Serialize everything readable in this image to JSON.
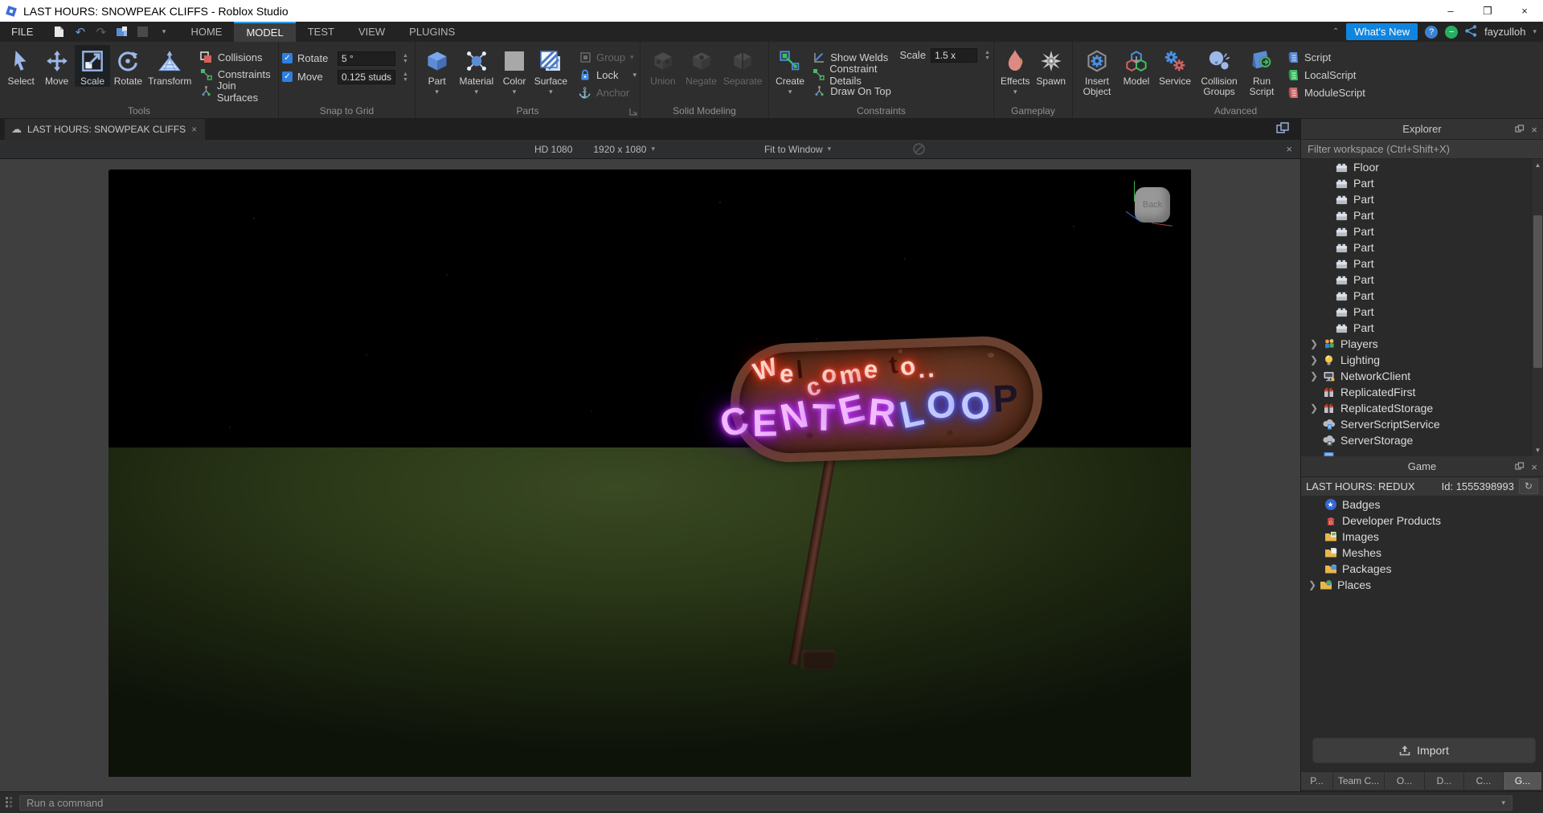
{
  "window": {
    "title": "LAST HOURS: SNOWPEAK CLIFFS - Roblox Studio",
    "minimize": "–",
    "restore": "❐",
    "close": "×"
  },
  "menu": {
    "file": "FILE",
    "tabs": [
      "HOME",
      "MODEL",
      "TEST",
      "VIEW",
      "PLUGINS"
    ],
    "active_tab": "MODEL",
    "whats_new": "What's New",
    "help": "?",
    "username": "fayzulloh"
  },
  "ribbon": {
    "section_labels": [
      "Tools",
      "Snap to Grid",
      "Parts",
      "Solid Modeling",
      "Constraints",
      "Gameplay",
      "Advanced"
    ],
    "tools": [
      {
        "label": "Select"
      },
      {
        "label": "Move"
      },
      {
        "label": "Scale"
      },
      {
        "label": "Rotate"
      },
      {
        "label": "Transform"
      }
    ],
    "toggles": [
      {
        "label": "Collisions"
      },
      {
        "label": "Constraints"
      },
      {
        "label": "Join Surfaces"
      }
    ],
    "snap": {
      "rotate_label": "Rotate",
      "rotate_value": "5 °",
      "move_label": "Move",
      "move_value": "0.125 studs"
    },
    "parts": {
      "tiles": [
        {
          "label": "Part"
        },
        {
          "label": "Material"
        },
        {
          "label": "Color"
        },
        {
          "label": "Surface"
        }
      ],
      "modifiers": [
        {
          "label": "Group"
        },
        {
          "label": "Lock"
        },
        {
          "label": "Anchor"
        }
      ]
    },
    "solid": [
      {
        "label": "Union"
      },
      {
        "label": "Negate"
      },
      {
        "label": "Separate"
      }
    ],
    "constraints": {
      "create": "Create",
      "options": [
        {
          "label": "Show Welds"
        },
        {
          "label": "Constraint Details"
        },
        {
          "label": "Draw On Top"
        }
      ],
      "scale_label": "Scale",
      "scale_value": "1.5 x"
    },
    "gameplay": [
      {
        "label": "Effects"
      },
      {
        "label": "Spawn"
      }
    ],
    "advanced": {
      "tiles": [
        {
          "label": "Insert Object"
        },
        {
          "label": "Model"
        },
        {
          "label": "Service"
        },
        {
          "label": "Collision Groups"
        },
        {
          "label": "Run Script"
        }
      ],
      "scripts": [
        {
          "label": "Script"
        },
        {
          "label": "LocalScript"
        },
        {
          "label": "ModuleScript"
        }
      ]
    }
  },
  "document": {
    "tab": "LAST HOURS: SNOWPEAK CLIFFS"
  },
  "emulation": {
    "device": "HD 1080",
    "resolution": "1920 x 1080",
    "fit": "Fit to Window"
  },
  "viewport": {
    "viewcube": "Back",
    "sign": {
      "line1": "Welcome to..",
      "line2_main": "CENTER",
      "line2_blue": "LOO",
      "line2_dark": "P"
    }
  },
  "explorer": {
    "title": "Explorer",
    "filter_placeholder": "Filter workspace (Ctrl+Shift+X)",
    "items": [
      {
        "label": "Floor"
      },
      {
        "label": "Part"
      },
      {
        "label": "Part"
      },
      {
        "label": "Part"
      },
      {
        "label": "Part"
      },
      {
        "label": "Part"
      },
      {
        "label": "Part"
      },
      {
        "label": "Part"
      },
      {
        "label": "Part"
      },
      {
        "label": "Part"
      },
      {
        "label": "Part"
      },
      {
        "label": "Players"
      },
      {
        "label": "Lighting"
      },
      {
        "label": "NetworkClient"
      },
      {
        "label": "ReplicatedFirst"
      },
      {
        "label": "ReplicatedStorage"
      },
      {
        "label": "ServerScriptService"
      },
      {
        "label": "ServerStorage"
      }
    ]
  },
  "game": {
    "title": "Game",
    "name": "LAST HOURS: REDUX",
    "id": "Id: 1555398993",
    "items": [
      {
        "label": "Badges"
      },
      {
        "label": "Developer Products"
      },
      {
        "label": "Images"
      },
      {
        "label": "Meshes"
      },
      {
        "label": "Packages"
      },
      {
        "label": "Places"
      }
    ]
  },
  "footer": {
    "import_label": "Import",
    "dock_tabs": [
      "P...",
      "Team C...",
      "O...",
      "D...",
      "C...",
      "G..."
    ],
    "command_placeholder": "Run a command"
  }
}
